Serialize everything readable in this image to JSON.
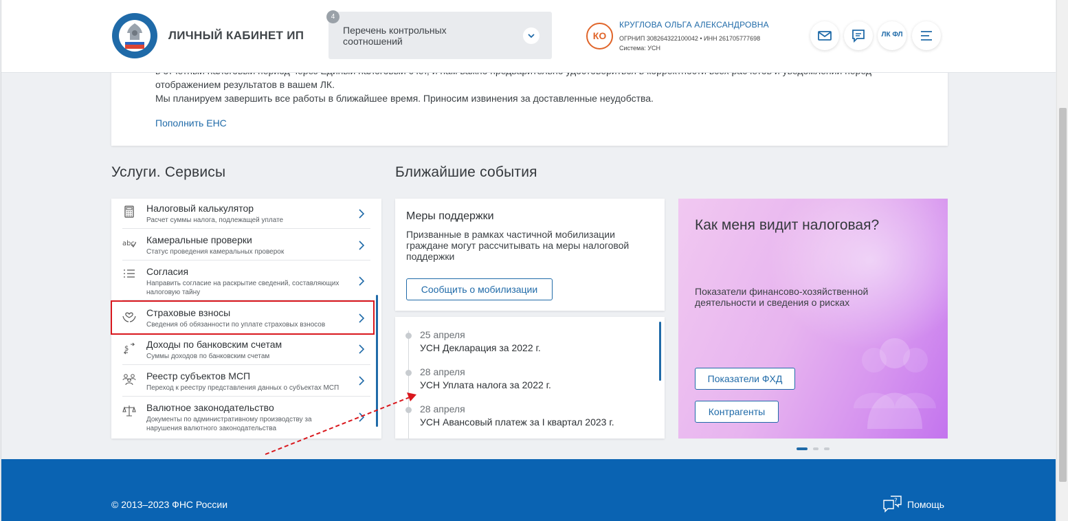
{
  "header": {
    "cabinet_title": "ЛИЧНЫЙ КАБИНЕТ ИП",
    "ratio_select": {
      "badge": "4",
      "label": "Перечень контрольных соотношений"
    },
    "user": {
      "initials": "КО",
      "name": "КРУГЛОВА ОЛЬГА АЛЕКСАНДРОВНА",
      "ids": "ОГРНИП 308264322100042 • ИНН 261705777698",
      "system": "Система: УСН"
    },
    "lkfl_label": "ЛК ФЛ",
    "accent_color": "#1f6aa8",
    "avatar_color": "#e0652a"
  },
  "notice": {
    "line_partial": "в отчетный налоговый период через Единый налоговый счет, и нам важно предварительно удостовериться в корректности всех расчетов и уведомлений перед",
    "line1": "отображением результатов в вашем ЛК.",
    "line2": "Мы планируем завершить все работы в ближайшее время. Приносим извинения за доставленные неудобства.",
    "link": "Пополнить ЕНС"
  },
  "services": {
    "title": "Услуги. Сервисы",
    "items": [
      {
        "title": "Налоговый калькулятор",
        "subtitle": "Расчет суммы налога, подлежащей уплате",
        "icon": "calculator-icon"
      },
      {
        "title": "Камеральные проверки",
        "subtitle": "Статус проведения камеральных проверок",
        "icon": "abc-check-icon"
      },
      {
        "title": "Согласия",
        "subtitle": "Направить согласие на раскрытие сведений, составляющих налоговую тайну",
        "icon": "list-icon"
      },
      {
        "title": "Страховые взносы",
        "subtitle": "Сведения об обязанности по уплате страховых взносов",
        "icon": "hands-heart-icon"
      },
      {
        "title": "Доходы по банковским счетам",
        "subtitle": "Суммы доходов по банковским счетам",
        "icon": "money-exchange-icon"
      },
      {
        "title": "Реестр субъектов МСП",
        "subtitle": "Переход к реестру представления данных о субъектах МСП",
        "icon": "people-group-icon"
      },
      {
        "title": "Валютное законодательство",
        "subtitle": "Документы по административному производству за нарушения валютного законодательства",
        "icon": "scales-icon"
      }
    ],
    "highlight_color": "#d9171d"
  },
  "events": {
    "title": "Ближайшие события",
    "support": {
      "title": "Меры поддержки",
      "text": "Призванные в рамках частичной мобилизации граждане могут рассчитывать на меры налоговой поддержки",
      "button": "Сообщить о мобилизации"
    },
    "list": [
      {
        "date": "25 апреля",
        "name": "УСН Декларация за 2022 г."
      },
      {
        "date": "28 апреля",
        "name": "УСН Уплата налога за 2022 г."
      },
      {
        "date": "28 апреля",
        "name": "УСН Авансовый платеж за I квартал 2023 г."
      }
    ]
  },
  "promo": {
    "title": "Как меня видит налоговая?",
    "text": "Показатели финансово-хозяйственной деятельности и сведения о рисках",
    "button1": "Показатели ФХД",
    "button2": "Контрагенты"
  },
  "footer": {
    "copyright": "© 2013–2023 ФНС России",
    "help": "Помощь",
    "background": "#0a63b2"
  }
}
